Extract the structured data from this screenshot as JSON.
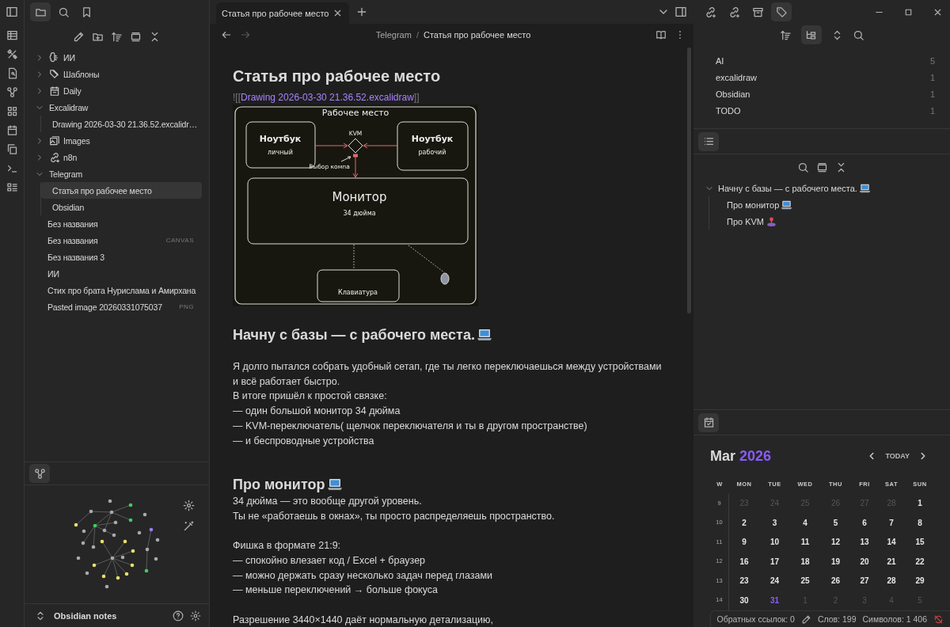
{
  "left_sidebar_tabs": [
    {
      "selected": true
    },
    {
      "selected": false
    },
    {
      "selected": false
    }
  ],
  "file_tree": [
    {
      "kind": "folder",
      "name": "ИИ",
      "has_icon": true,
      "expanded": false,
      "selected": false
    },
    {
      "kind": "folder",
      "name": "Шаблоны",
      "has_icon": true,
      "expanded": false,
      "selected": false
    },
    {
      "kind": "folder",
      "name": "Daily",
      "has_icon": true,
      "expanded": false,
      "selected": false
    },
    {
      "kind": "folder",
      "name": "Excalidraw",
      "has_icon": false,
      "expanded": true,
      "selected": false,
      "children": [
        {
          "name": "Drawing 2026-03-30 21.36.52.excalidr…",
          "selected": false
        }
      ]
    },
    {
      "kind": "folder",
      "name": "Images",
      "has_icon": true,
      "expanded": false,
      "selected": false
    },
    {
      "kind": "folder",
      "name": "n8n",
      "has_icon": true,
      "expanded": false,
      "selected": false
    },
    {
      "kind": "folder",
      "name": "Telegram",
      "has_icon": false,
      "expanded": true,
      "selected": false,
      "children": [
        {
          "name": "Статья про рабочее место",
          "selected": true
        },
        {
          "name": "Obsidian",
          "selected": false
        }
      ]
    },
    {
      "kind": "file",
      "name": "Без названия",
      "selected": false
    },
    {
      "kind": "file",
      "name": "Без названия",
      "badge": "CANVAS",
      "selected": false
    },
    {
      "kind": "file",
      "name": "Без названия 3",
      "selected": false
    },
    {
      "kind": "file",
      "name": "ИИ",
      "selected": false
    },
    {
      "kind": "file",
      "name": "Стих про брата Нурислама и Амирхана",
      "selected": false
    },
    {
      "kind": "file",
      "name": "Pasted image 20260331075037",
      "badge": "PNG",
      "selected": false
    }
  ],
  "vault_name": "Obsidian notes",
  "tabs": [
    {
      "title": "Статья про рабочее место",
      "selected": true
    }
  ],
  "breadcrumb": {
    "parent": "Telegram",
    "separator": "/",
    "current": "Статья про рабочее место"
  },
  "blocks": [
    {
      "kind": "h1",
      "text": "Статья про рабочее место"
    },
    {
      "kind": "embed",
      "prefix": "![[",
      "link": "Drawing 2026-03-30 21.36.52.excalidraw",
      "suffix": "]]"
    },
    {
      "kind": "drawing",
      "title": "Рабочее место",
      "kvm": "KVM",
      "left_title": "Ноутбук",
      "left_subtitle": "личный",
      "right_title": "Ноутбук",
      "right_subtitle": "рабочий",
      "switch_label": "Выбор компа",
      "monitor_title": "Монитор",
      "monitor_subtitle": "34 дюйма",
      "keyboard": "Клавиатура"
    },
    {
      "kind": "h2",
      "text": "Начну с базы — с рабочего места.",
      "emoji": true
    },
    {
      "kind": "p",
      "lines": [
        "Я долго пытался собрать удобный сетап, где ты легко переключаешься между устройствами и всё работает быстро.",
        "В итоге пришёл к простой связке:",
        "— один большой монитор 34 дюйма",
        "— KVM-переключатель( щелчок переключателя и ты в другом пространстве)",
        "— и беспроводные устройства"
      ]
    },
    {
      "kind": "h2",
      "text": "Про монитор",
      "emoji": true
    },
    {
      "kind": "p",
      "lines": [
        "34 дюйма — это вообще другой уровень.",
        "Ты не «работаешь в окнах», ты просто распределяешь пространство."
      ]
    },
    {
      "kind": "p",
      "lines": [
        "Фишка в формате 21:9:",
        "— спокойно влезает код / Excel + браузер",
        "— можно держать сразу несколько задач перед глазами",
        "— меньше переключений → больше фокуса"
      ]
    },
    {
      "kind": "p",
      "lines": [
        "Разрешение 3440×1440 даёт нормальную детализацию,"
      ]
    }
  ],
  "right_top_tabs": [
    {
      "selected": false
    },
    {
      "selected": false
    },
    {
      "selected": false
    },
    {
      "selected": true
    }
  ],
  "tags_view": {
    "nested": true,
    "tags": [
      {
        "name": "AI",
        "count": "5"
      },
      {
        "name": "excalidraw",
        "count": "1"
      },
      {
        "name": "Obsidian",
        "count": "1"
      },
      {
        "name": "TODO",
        "count": "1"
      }
    ]
  },
  "outline": [
    {
      "text": "Начну с базы — с рабочего места.",
      "emoji": true,
      "expanded": true,
      "children": [
        {
          "text": "Про монитор",
          "emoji": true
        },
        {
          "text": "Про KVM",
          "emoji": true
        }
      ]
    }
  ],
  "calendar": {
    "month": "Mar",
    "year": "2026",
    "today_label": "TODAY",
    "headers": [
      "W",
      "MON",
      "TUE",
      "WED",
      "THU",
      "FRI",
      "SAT",
      "SUN"
    ],
    "weeks": [
      {
        "week": "9",
        "days": [
          {
            "d": "23",
            "other_month": true,
            "today": false
          },
          {
            "d": "24",
            "other_month": true,
            "today": false
          },
          {
            "d": "25",
            "other_month": true,
            "today": false
          },
          {
            "d": "26",
            "other_month": true,
            "today": false
          },
          {
            "d": "27",
            "other_month": true,
            "today": false
          },
          {
            "d": "28",
            "other_month": true,
            "today": false
          },
          {
            "d": "1",
            "other_month": false,
            "today": false
          }
        ]
      },
      {
        "week": "10",
        "days": [
          {
            "d": "2",
            "other_month": false,
            "today": false
          },
          {
            "d": "3",
            "other_month": false,
            "today": false
          },
          {
            "d": "4",
            "other_month": false,
            "today": false
          },
          {
            "d": "5",
            "other_month": false,
            "today": false
          },
          {
            "d": "6",
            "other_month": false,
            "today": false
          },
          {
            "d": "7",
            "other_month": false,
            "today": false
          },
          {
            "d": "8",
            "other_month": false,
            "today": false
          }
        ]
      },
      {
        "week": "11",
        "days": [
          {
            "d": "9",
            "other_month": false,
            "today": false
          },
          {
            "d": "10",
            "other_month": false,
            "today": false
          },
          {
            "d": "11",
            "other_month": false,
            "today": false
          },
          {
            "d": "12",
            "other_month": false,
            "today": false
          },
          {
            "d": "13",
            "other_month": false,
            "today": false
          },
          {
            "d": "14",
            "other_month": false,
            "today": false
          },
          {
            "d": "15",
            "other_month": false,
            "today": false
          }
        ]
      },
      {
        "week": "12",
        "days": [
          {
            "d": "16",
            "other_month": false,
            "today": false
          },
          {
            "d": "17",
            "other_month": false,
            "today": false
          },
          {
            "d": "18",
            "other_month": false,
            "today": false
          },
          {
            "d": "19",
            "other_month": false,
            "today": false
          },
          {
            "d": "20",
            "other_month": false,
            "today": false
          },
          {
            "d": "21",
            "other_month": false,
            "today": false
          },
          {
            "d": "22",
            "other_month": false,
            "today": false
          }
        ]
      },
      {
        "week": "13",
        "days": [
          {
            "d": "23",
            "other_month": false,
            "today": false
          },
          {
            "d": "24",
            "other_month": false,
            "today": false
          },
          {
            "d": "25",
            "other_month": false,
            "today": false
          },
          {
            "d": "26",
            "other_month": false,
            "today": false
          },
          {
            "d": "27",
            "other_month": false,
            "today": false
          },
          {
            "d": "28",
            "other_month": false,
            "today": false
          },
          {
            "d": "29",
            "other_month": false,
            "today": false
          }
        ]
      },
      {
        "week": "14",
        "days": [
          {
            "d": "30",
            "other_month": false,
            "today": false
          },
          {
            "d": "31",
            "other_month": false,
            "today": true
          },
          {
            "d": "1",
            "other_month": true,
            "today": false
          },
          {
            "d": "2",
            "other_month": true,
            "today": false
          },
          {
            "d": "3",
            "other_month": true,
            "today": false
          },
          {
            "d": "4",
            "other_month": true,
            "today": false
          },
          {
            "d": "5",
            "other_month": true,
            "today": false
          }
        ]
      }
    ]
  },
  "status_bar": {
    "backlinks": "Обратных ссылок: 0",
    "words": "Слов: 199",
    "chars": "Символов: 1 406",
    "sync_error": true
  }
}
